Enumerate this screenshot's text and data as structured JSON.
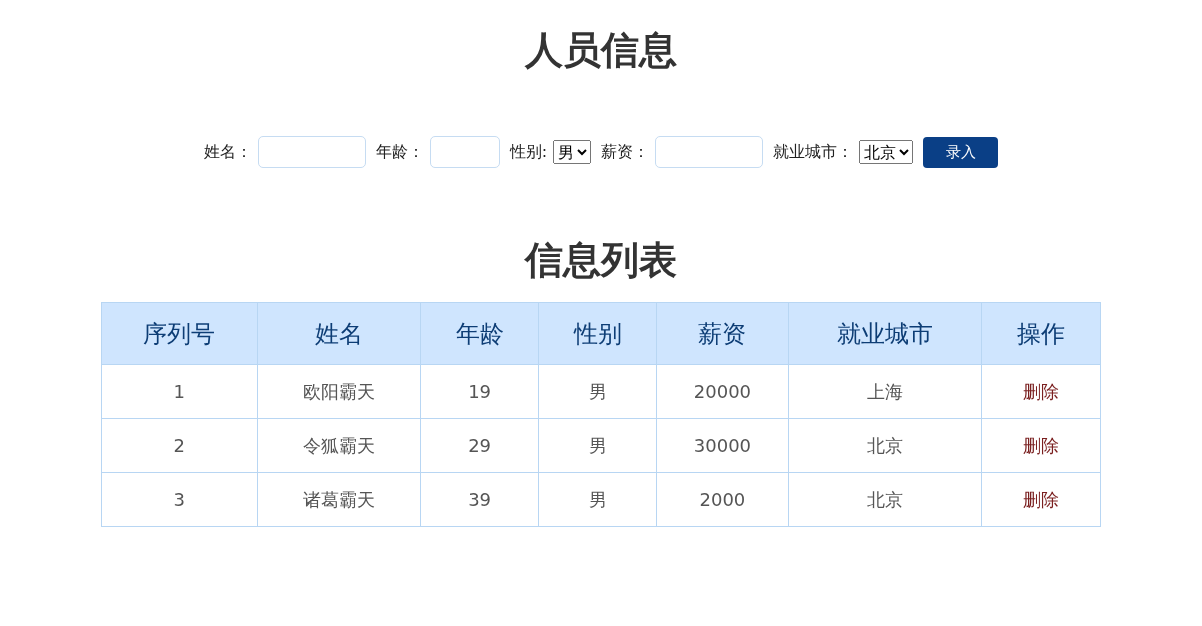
{
  "title": "人员信息",
  "form": {
    "fields": [
      {
        "kind": "input",
        "label": "姓名："
      },
      {
        "kind": "short_input",
        "label": "年龄："
      },
      {
        "kind": "select",
        "label": "性别:",
        "value": "男"
      },
      {
        "kind": "input",
        "label": "薪资："
      },
      {
        "kind": "select",
        "label": "就业城市：",
        "value": "北京"
      }
    ],
    "submit": "录入"
  },
  "list_title": "信息列表",
  "table": {
    "columns": [
      "序列号",
      "姓名",
      "年龄",
      "性别",
      "薪资",
      "就业城市",
      "操作"
    ],
    "rows": [
      {
        "cells": [
          "1",
          "欧阳霸天",
          "19",
          "男",
          "20000",
          "上海"
        ],
        "action": "删除"
      },
      {
        "cells": [
          "2",
          "令狐霸天",
          "29",
          "男",
          "30000",
          "北京"
        ],
        "action": "删除"
      },
      {
        "cells": [
          "3",
          "诸葛霸天",
          "39",
          "男",
          "2000",
          "北京"
        ],
        "action": "删除"
      }
    ]
  }
}
